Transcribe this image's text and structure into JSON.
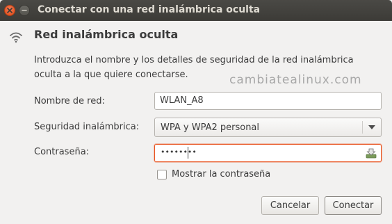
{
  "window": {
    "title": "Conectar con una red inalámbrica oculta"
  },
  "header": {
    "title": "Red inalámbrica oculta",
    "icon": "wifi-icon",
    "description": "Introduzca el nombre y los detalles de seguridad de la red inalámbrica oculta a la que quiere conectarse."
  },
  "watermark": "cambiatealinux.com",
  "form": {
    "network_name_label": "Nombre de red:",
    "network_name_value": "WLAN_A8",
    "security_label": "Seguridad inalámbrica:",
    "security_value": "WPA y WPA2 personal",
    "password_label": "Contraseña:",
    "password_masked": "••••••••",
    "show_password_label": "Mostrar la contraseña",
    "show_password_checked": false
  },
  "buttons": {
    "cancel": "Cancelar",
    "connect": "Conectar"
  },
  "colors": {
    "accent": "#e95420",
    "titlebar": "#3c3b37",
    "background": "#f2f1f0"
  }
}
